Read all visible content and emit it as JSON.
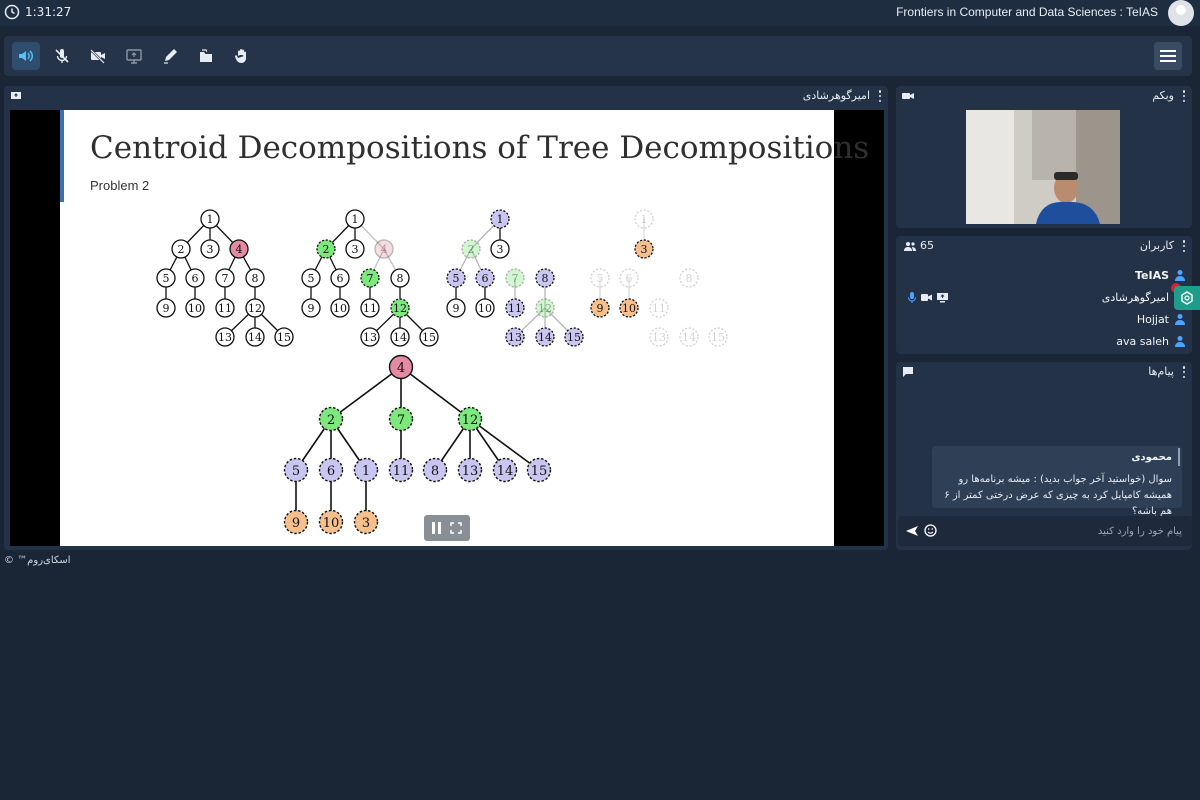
{
  "topbar": {
    "time": "1:31:27",
    "conference_title": "Frontiers in Computer and Data Sciences : TeIAS"
  },
  "toolbar": {
    "tools": [
      "speaker-icon",
      "mic-muted-icon",
      "camera-off-icon",
      "screen-share-icon",
      "pen-icon",
      "files-icon",
      "raise-hand-icon"
    ],
    "menu": "hamburger-icon"
  },
  "presentation": {
    "panel_title": "امیرگوهرشادی",
    "slide_title": "Centroid Decompositions of Tree Decompositions",
    "slide_subtitle": "Problem 2",
    "colors": {
      "pink": "#e58aa3",
      "green": "#7ee87e",
      "blue": "#c9c7f2",
      "orange": "#f6c08e",
      "accent": "#3c6fb0"
    }
  },
  "webcam": {
    "panel_title": "وبکم"
  },
  "users": {
    "panel_title": "کاربران",
    "count": "65",
    "list": [
      "TeIAS",
      "امیرگوهرشادی",
      "Hojjat",
      "ava saleh"
    ]
  },
  "messages": {
    "panel_title": "پیام‌ها",
    "items": [
      {
        "author": "محمودی",
        "text": "سوال (خواستید آخر جواب بدید) : میشه برنامه‌ها رو همیشه کامپایل کرد به چیزی که عرض درختی کمتر از ۶ هم باشه؟"
      }
    ],
    "input_placeholder": "پیام خود را وارد کنید"
  },
  "footer": {
    "brand": "اسکای‌روم™ ©"
  }
}
